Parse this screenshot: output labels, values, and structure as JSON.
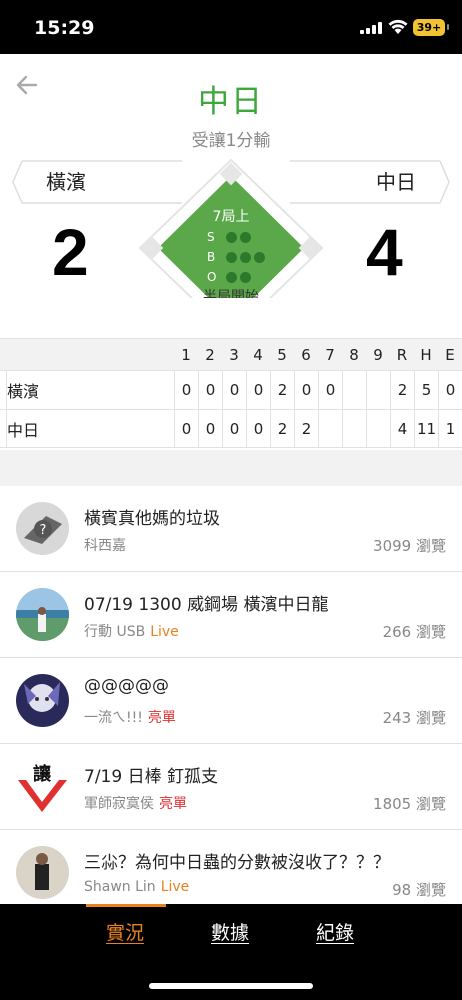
{
  "status_bar": {
    "time": "15:29",
    "battery": "39+"
  },
  "header": {
    "title": "中日",
    "subtitle": "受讓1分輸"
  },
  "scoreboard": {
    "away": {
      "name": "橫濱",
      "score": "2"
    },
    "home": {
      "name": "中日",
      "score": "4"
    },
    "inning": "7局上",
    "count_labels": {
      "s": "S",
      "b": "B",
      "o": "O"
    },
    "half_status": "半局開始"
  },
  "box_score": {
    "columns": [
      "1",
      "2",
      "3",
      "4",
      "5",
      "6",
      "7",
      "8",
      "9",
      "R",
      "H",
      "E"
    ],
    "rows": [
      {
        "team": "橫濱",
        "cells": [
          "0",
          "0",
          "0",
          "0",
          "2",
          "0",
          "0",
          "",
          "",
          "2",
          "5",
          "0"
        ]
      },
      {
        "team": "中日",
        "cells": [
          "0",
          "0",
          "0",
          "0",
          "2",
          "2",
          "",
          "",
          "",
          "4",
          "11",
          "1"
        ]
      }
    ]
  },
  "posts": [
    {
      "title": "橫賓真他媽的垃圾",
      "author": "科西嘉",
      "badge": "",
      "views": "3099 瀏覽",
      "avatar": "default-avatar"
    },
    {
      "title": "07/19 1300 威鋼場 橫濱中日龍",
      "author": "行動 USB",
      "badge": "Live",
      "views": "266 瀏覽",
      "avatar": "photo-beach"
    },
    {
      "title": "@@@@@",
      "author": "一流ㄟ!!!",
      "badge": "亮單",
      "views": "243 瀏覽",
      "avatar": "photo-anime"
    },
    {
      "title": "7/19 日棒 釘孤支",
      "author": "軍師寂寞侯",
      "badge": "亮單",
      "views": "1805 瀏覽",
      "avatar": "logo-rang"
    },
    {
      "title": "三尛？為何中日蟲的分數被沒收了？？？",
      "author": "Shawn Lin",
      "badge": "Live",
      "views": "98 瀏覽",
      "avatar": "photo-person"
    }
  ],
  "avatar_logo_text": "讓",
  "tabs": [
    {
      "label": "實況",
      "active": true
    },
    {
      "label": "數據",
      "active": false
    },
    {
      "label": "紀錄",
      "active": false
    }
  ],
  "colors": {
    "accent_green": "#3aa83a",
    "accent_orange": "#e8821e",
    "red_badge": "#e03030"
  }
}
